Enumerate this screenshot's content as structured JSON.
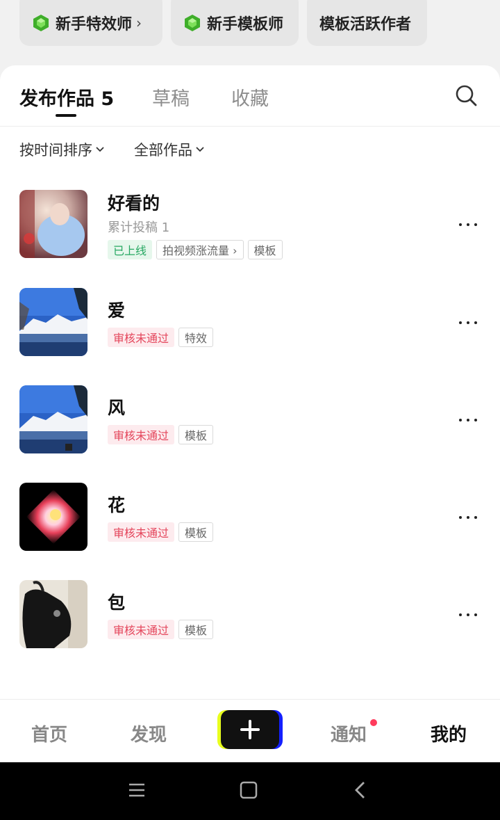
{
  "badges": [
    {
      "label": "新手特效师",
      "chevron": "›",
      "icon": "gem-icon"
    },
    {
      "label": "新手模板师",
      "icon": "gem-icon"
    },
    {
      "label": "模板活跃作者"
    }
  ],
  "tabs": {
    "published": "发布作品 5",
    "drafts": "草稿",
    "favorites": "收藏"
  },
  "filters": {
    "sort": "按时间排序",
    "scope": "全部作品"
  },
  "items": [
    {
      "title": "好看的",
      "sub": "累计投稿 1",
      "tags": [
        "已上线",
        "拍视频涨流量 ›",
        "模板"
      ]
    },
    {
      "title": "爱",
      "tags": [
        "审核未通过",
        "特效"
      ]
    },
    {
      "title": "风",
      "tags": [
        "审核未通过",
        "模板"
      ]
    },
    {
      "title": "花",
      "tags": [
        "审核未通过",
        "模板"
      ]
    },
    {
      "title": "包",
      "tags": [
        "审核未通过",
        "模板"
      ]
    }
  ],
  "bottom_nav": {
    "home": "首页",
    "discover": "发现",
    "notify": "通知",
    "mine": "我的"
  },
  "colors": {
    "online_green": "#27a862",
    "reject_red": "#e4455b",
    "notify_dot": "#ff3b5c"
  }
}
